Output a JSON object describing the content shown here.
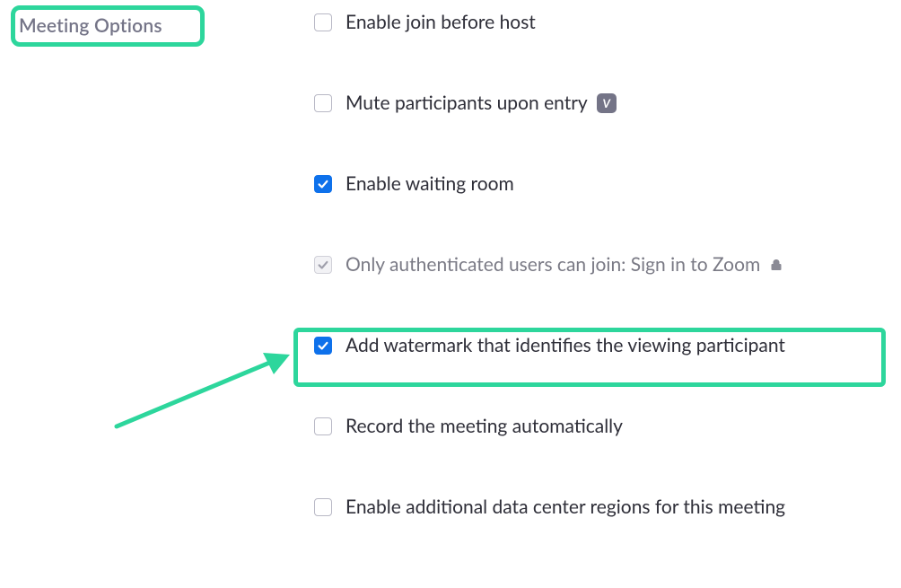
{
  "section": {
    "title": "Meeting Options"
  },
  "options": [
    {
      "label": "Enable join before host",
      "checked": false,
      "disabled": false,
      "badge": null,
      "locked": false
    },
    {
      "label": "Mute participants upon entry",
      "checked": false,
      "disabled": false,
      "badge": "V",
      "locked": false
    },
    {
      "label": "Enable waiting room",
      "checked": true,
      "disabled": false,
      "badge": null,
      "locked": false
    },
    {
      "label": "Only authenticated users can join: Sign in to Zoom",
      "checked": true,
      "disabled": true,
      "badge": null,
      "locked": true
    },
    {
      "label": "Add watermark that identifies the viewing participant",
      "checked": true,
      "disabled": false,
      "badge": null,
      "locked": false
    },
    {
      "label": "Record the meeting automatically",
      "checked": false,
      "disabled": false,
      "badge": null,
      "locked": false
    },
    {
      "label": "Enable additional data center regions for this meeting",
      "checked": false,
      "disabled": false,
      "badge": null,
      "locked": false
    }
  ],
  "annotations": {
    "highlight_color": "#2dd69c"
  }
}
